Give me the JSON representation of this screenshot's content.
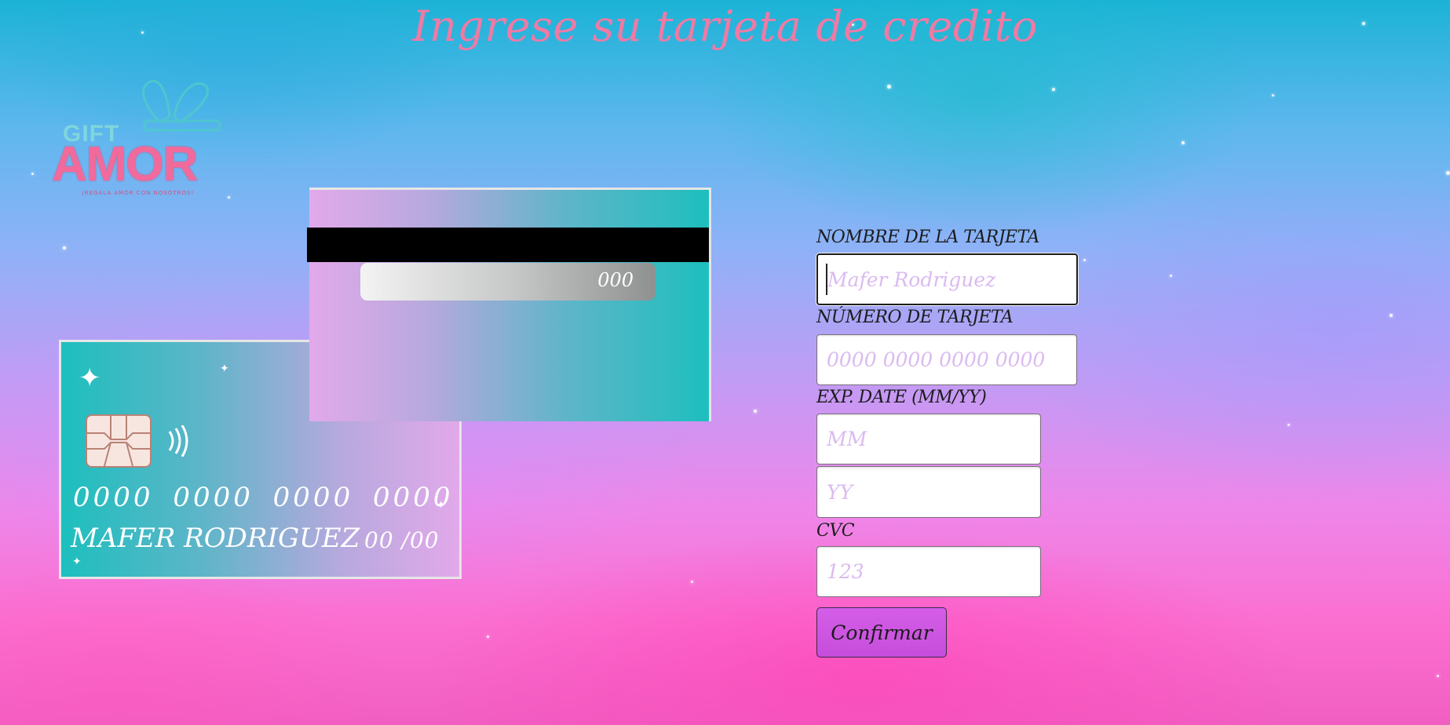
{
  "page": {
    "title": "Ingrese su tarjeta de credito"
  },
  "logo": {
    "gift": "GIFT",
    "amor": "AMOR",
    "tagline": "¡REGALA AMOR CON NOSOTROS!"
  },
  "card_front": {
    "number": "0000 0000 0000 0000",
    "holder": "MAFER RODRIGUEZ",
    "expiry": "00 /00"
  },
  "card_back": {
    "cvc": "000"
  },
  "form": {
    "name_label": "NOMBRE DE LA TARJETA",
    "name_placeholder": "Mafer Rodriguez",
    "number_label": "NÚMERO DE TARJETA",
    "number_placeholder": "0000 0000 0000 0000",
    "exp_label": "EXP. DATE (MM/YY)",
    "month_placeholder": "MM",
    "year_placeholder": "YY",
    "cvc_label": "CVC",
    "cvc_placeholder": "123",
    "confirm_label": "Confirmar"
  },
  "colors": {
    "title": "#f07aa4",
    "button": "#d55ee8",
    "placeholder": "#dbbaf0",
    "card_teal": "#1dbfbe",
    "card_pink": "#e2a9ea"
  },
  "icons": {
    "chip": "chip-icon",
    "contactless": "contactless-icon",
    "sparkle": "sparkle-icon",
    "gift_bow": "gift-bow-icon"
  }
}
